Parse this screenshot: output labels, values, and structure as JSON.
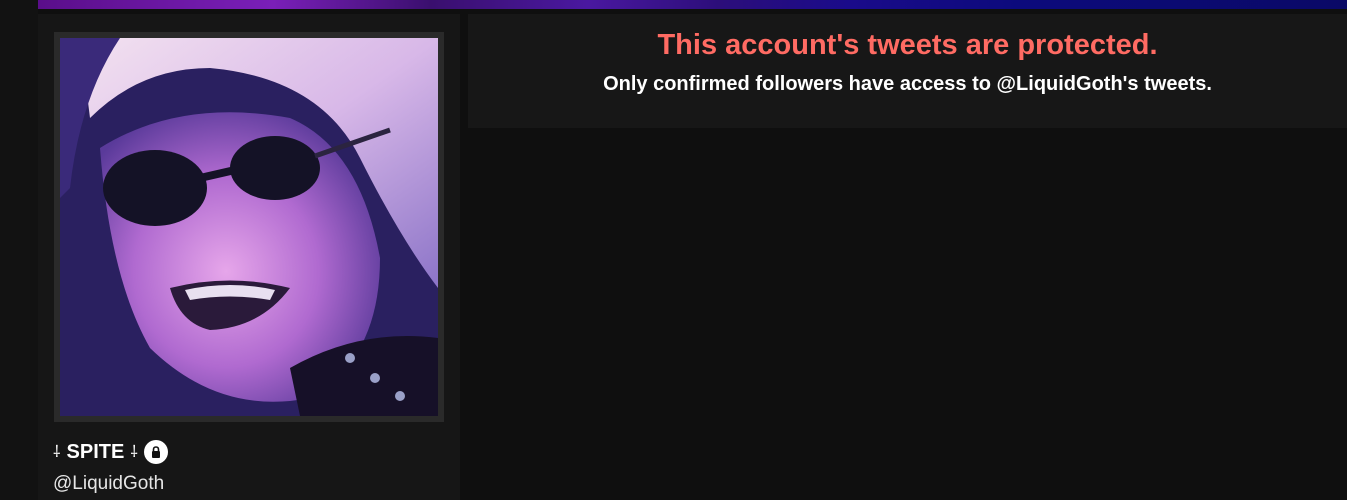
{
  "profile": {
    "name": "SPITE",
    "name_prefix_glyph": "⸸",
    "name_suffix_glyph": "⸸",
    "handle": "@LiquidGoth",
    "verified_icon": "lock-icon",
    "avatar_alt": "profile picture"
  },
  "protected": {
    "title": "This account's tweets are protected.",
    "subtitle": "Only confirmed followers have access to @LiquidGoth's tweets."
  },
  "colors": {
    "background": "#0f0f0f",
    "panel": "#171717",
    "accent_red": "#ff6b63",
    "text": "#ffffff"
  }
}
